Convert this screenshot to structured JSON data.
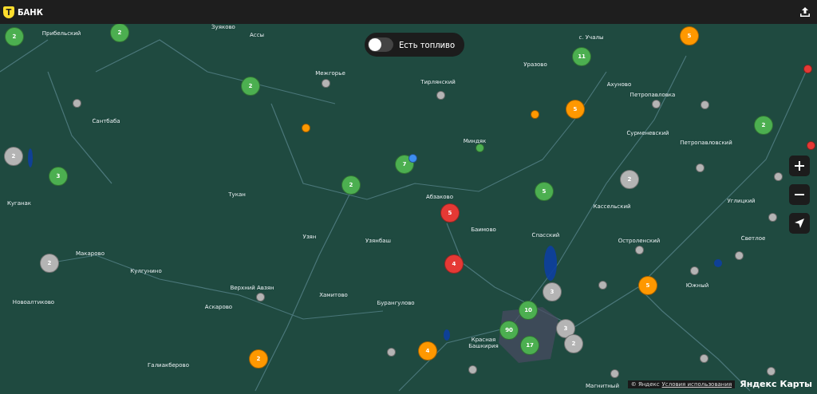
{
  "header": {
    "logo_mark": "Т",
    "logo_text": "БАНК"
  },
  "fuel_filter": {
    "label": "Есть топливо",
    "on": false
  },
  "map": {
    "places": [
      {
        "name": "Зуяково"
      },
      {
        "name": "Прибельский"
      },
      {
        "name": "Ассы"
      },
      {
        "name": "с. Учалы"
      },
      {
        "name": "Уразово"
      },
      {
        "name": "Межгорье"
      },
      {
        "name": "Тирлянский"
      },
      {
        "name": "Ахуново"
      },
      {
        "name": "Петропавловка"
      },
      {
        "name": "Сантбаба"
      },
      {
        "name": "Сурменевский"
      },
      {
        "name": "Миндяк"
      },
      {
        "name": "Петропавловский"
      },
      {
        "name": "Тукан"
      },
      {
        "name": "Абзаково"
      },
      {
        "name": "Углицкий"
      },
      {
        "name": "Куганак"
      },
      {
        "name": "Кассельский"
      },
      {
        "name": "Баимово"
      },
      {
        "name": "Спасский"
      },
      {
        "name": "Узян"
      },
      {
        "name": "Светлое"
      },
      {
        "name": "Узянбаш"
      },
      {
        "name": "Остроленский"
      },
      {
        "name": "Макарово"
      },
      {
        "name": "Кулгунино"
      },
      {
        "name": "Южный"
      },
      {
        "name": "Верхний Авзян"
      },
      {
        "name": "Хамитово"
      },
      {
        "name": "Новоалтиково"
      },
      {
        "name": "Бурангулово"
      },
      {
        "name": "Аскарово"
      },
      {
        "name": "Красная Башкирия"
      },
      {
        "name": "Галиакберово"
      },
      {
        "name": "Магнитный"
      }
    ],
    "clusters": [
      {
        "count": "2",
        "color": "#4caf50"
      },
      {
        "count": "2",
        "color": "#4caf50"
      },
      {
        "count": "2",
        "color": "#4caf50"
      },
      {
        "count": "2",
        "color": "#b4b4b4"
      },
      {
        "count": "3",
        "color": "#4caf50"
      },
      {
        "count": "2",
        "color": "#4caf50"
      },
      {
        "count": "7",
        "color": "#4caf50"
      },
      {
        "count": "5",
        "color": "#e53935"
      },
      {
        "count": "4",
        "color": "#e53935"
      },
      {
        "count": "11",
        "color": "#4caf50"
      },
      {
        "count": "5",
        "color": "#ff9800"
      },
      {
        "count": "5",
        "color": "#ff9800"
      },
      {
        "count": "2",
        "color": "#4caf50"
      },
      {
        "count": "2",
        "color": "#b4b4b4"
      },
      {
        "count": "5",
        "color": "#4caf50"
      },
      {
        "count": "2",
        "color": "#b4b4b4"
      },
      {
        "count": "5",
        "color": "#ff9800"
      },
      {
        "count": "3",
        "color": "#b4b4b4"
      },
      {
        "count": "10",
        "color": "#4caf50"
      },
      {
        "count": "90",
        "color": "#4caf50"
      },
      {
        "count": "3",
        "color": "#b4b4b4"
      },
      {
        "count": "2",
        "color": "#b4b4b4"
      },
      {
        "count": "17",
        "color": "#4caf50"
      },
      {
        "count": "4",
        "color": "#ff9800"
      },
      {
        "count": "2",
        "color": "#ff9800"
      }
    ],
    "points": [
      {
        "color": "#b4b4b4"
      },
      {
        "color": "#ff9800"
      },
      {
        "color": "#b4b4b4"
      },
      {
        "color": "#b4b4b4"
      },
      {
        "color": "#ff9800"
      },
      {
        "color": "#4caf50"
      },
      {
        "color": "#3d8ef0"
      },
      {
        "color": "#b4b4b4"
      },
      {
        "color": "#b4b4b4"
      },
      {
        "color": "#e53935"
      },
      {
        "color": "#e53935"
      },
      {
        "color": "#b4b4b4"
      },
      {
        "color": "#b4b4b4"
      },
      {
        "color": "#b4b4b4"
      },
      {
        "color": "#b4b4b4"
      },
      {
        "color": "#b4b4b4"
      },
      {
        "color": "#b4b4b4"
      },
      {
        "color": "#b4b4b4"
      },
      {
        "color": "#b4b4b4"
      },
      {
        "color": "#b4b4b4"
      },
      {
        "color": "#b4b4b4"
      },
      {
        "color": "#b4b4b4"
      },
      {
        "color": "#b4b4b4"
      },
      {
        "color": "#b4b4b4"
      }
    ]
  },
  "attribution": {
    "copyright": "© Яндекс",
    "terms_link": "Условия использования",
    "brand": "Яндекс Карты"
  }
}
